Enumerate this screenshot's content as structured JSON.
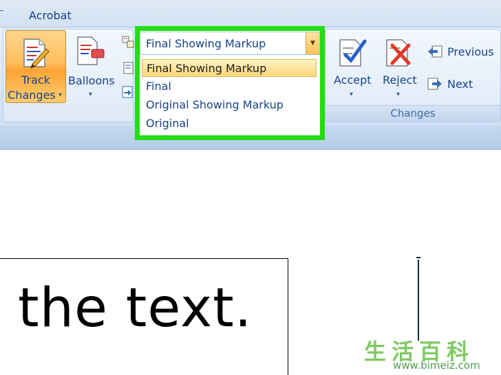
{
  "tabs": {
    "active": "Acrobat"
  },
  "ribbon": {
    "track_changes": {
      "line1": "Track",
      "line2": "Changes",
      "icon": "pencil-document-icon"
    },
    "balloons": {
      "label": "Balloons",
      "icon": "balloon-document-icon"
    },
    "display_for_review": {
      "selected": "Final Showing Markup",
      "options": [
        "Final Showing Markup",
        "Final",
        "Original Showing Markup",
        "Original"
      ]
    },
    "accept": {
      "label": "Accept",
      "icon": "checkmark-document-icon"
    },
    "reject": {
      "label": "Reject",
      "icon": "x-document-icon"
    },
    "previous": {
      "label": "Previous",
      "icon": "previous-arrow-icon"
    },
    "next": {
      "label": "Next",
      "icon": "next-arrow-icon"
    },
    "changes_group": "Changes"
  },
  "document": {
    "text": "the text."
  },
  "watermark": {
    "chars": "生活百科",
    "url": "www.bimeiz.com"
  },
  "colors": {
    "highlight_frame": "#22dd10",
    "button_active": "#ffbd5a",
    "ribbon_text": "#15428b"
  }
}
